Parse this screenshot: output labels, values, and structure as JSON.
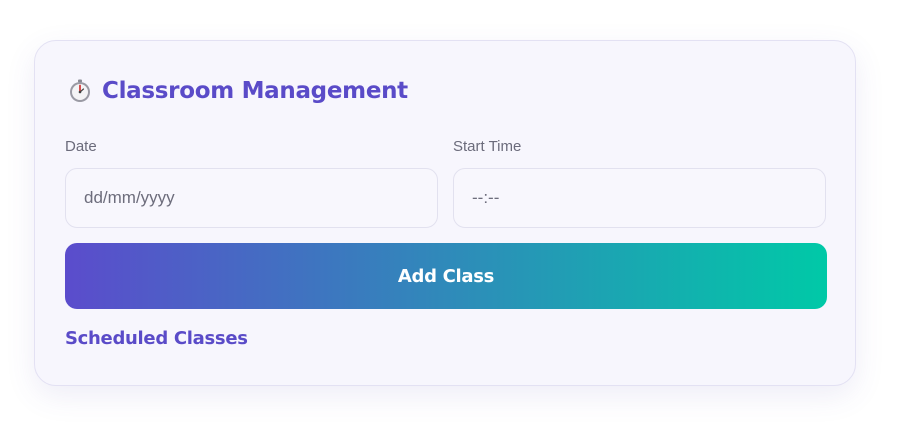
{
  "card": {
    "title": "Classroom Management",
    "icon": "stopwatch-icon"
  },
  "form": {
    "date_label": "Date",
    "date_placeholder": "dd/mm/yyyy",
    "time_label": "Start Time",
    "time_placeholder": "--:--",
    "add_button_label": "Add Class"
  },
  "section": {
    "scheduled_heading": "Scheduled Classes"
  },
  "colors": {
    "accent": "#5a4bc8",
    "gradient_start": "#5b4ccc",
    "gradient_end": "#00c9a7",
    "card_background": "#f7f6fd"
  }
}
